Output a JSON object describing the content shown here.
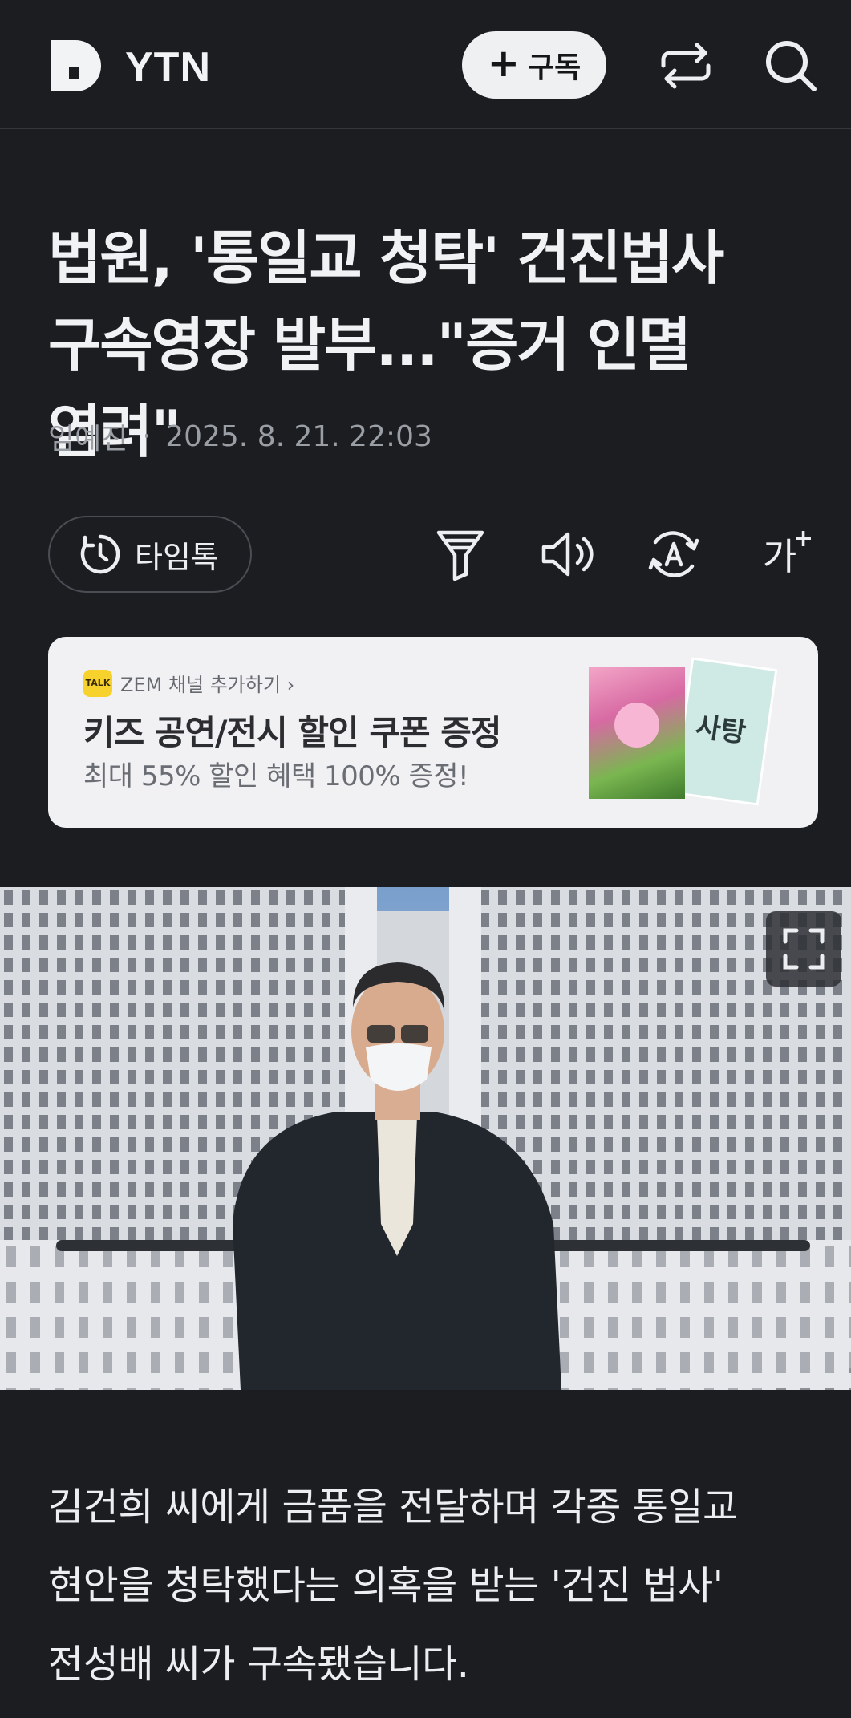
{
  "header": {
    "brand": "YTN",
    "subscribe_label": "구독",
    "icons": [
      "d-logo-icon",
      "share-icon",
      "search-icon"
    ]
  },
  "article": {
    "title": "법원, '통일교 청탁' 건진법사 구속영장 발부...\"증거 인멸 염려\"",
    "author": "임예진",
    "datetime": "2025. 8. 21. 22:03",
    "body": "김건희 씨에게 금품을 전달하며 각종 통일교 현안을 청탁했다는 의혹을 받는 '건진 법사' 전성배 씨가 구속됐습니다."
  },
  "toolbar": {
    "timetalk_label": "타임톡",
    "font_size_label": "가",
    "icons": [
      "timetalk-clock-icon",
      "summary-filter-icon",
      "speaker-icon",
      "translate-icon",
      "font-size-icon"
    ]
  },
  "ad": {
    "channel": "ZEM 채널 추가하기 ›",
    "badge": "TALK",
    "title": "키즈 공연/전시 할인 쿠폰 증정",
    "subtitle": "최대 55% 할인 혜택 100% 증정!",
    "poster_text": "사탕"
  },
  "colors": {
    "background": "#1b1d21",
    "text": "#eceef1",
    "meta": "#9a9ea5",
    "ad_bg": "#f1f1f3",
    "talk_yellow": "#f7d22c"
  }
}
